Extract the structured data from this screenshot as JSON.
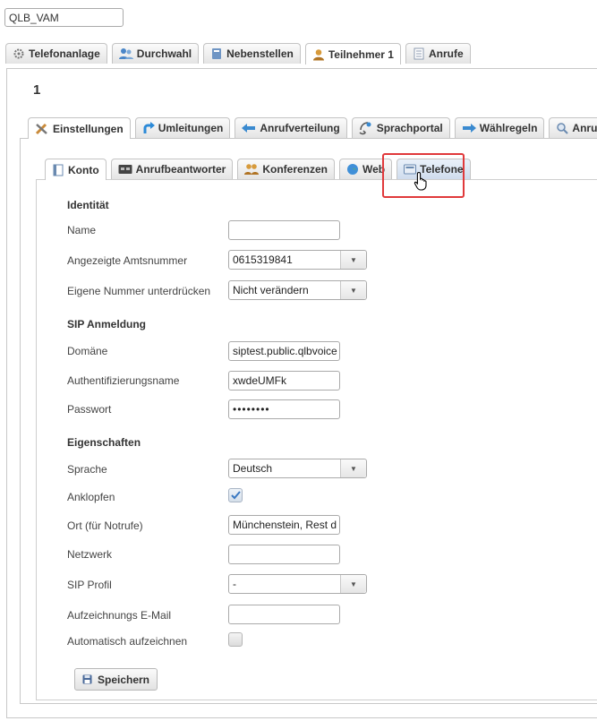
{
  "top_field": {
    "value": "QLB_VAM"
  },
  "main_tabs": [
    {
      "label": "Telefonanlage",
      "icon": "gear-icon"
    },
    {
      "label": "Durchwahl",
      "icon": "people-icon"
    },
    {
      "label": "Nebenstellen",
      "icon": "phonebook-icon"
    },
    {
      "label": "Teilnehmer 1",
      "icon": "user-icon",
      "active": true
    },
    {
      "label": "Anrufe",
      "icon": "list-icon"
    }
  ],
  "participant_number": "1",
  "sub_tabs": [
    {
      "label": "Einstellungen",
      "icon": "tools-icon",
      "active": true
    },
    {
      "label": "Umleitungen",
      "icon": "redirect-arrow-icon"
    },
    {
      "label": "Anrufverteilung",
      "icon": "distribution-arrow-icon"
    },
    {
      "label": "Sprachportal",
      "icon": "voice-portal-icon"
    },
    {
      "label": "Wählregeln",
      "icon": "dial-rules-arrow-icon"
    },
    {
      "label": "Anrufe",
      "icon": "call-search-icon"
    }
  ],
  "inner_tabs": [
    {
      "label": "Konto",
      "icon": "account-icon",
      "active": true
    },
    {
      "label": "Anrufbeantworter",
      "icon": "answering-machine-icon"
    },
    {
      "label": "Konferenzen",
      "icon": "conference-icon"
    },
    {
      "label": "Web",
      "icon": "globe-icon"
    },
    {
      "label": "Telefone",
      "icon": "phone-device-icon",
      "highlighted": true
    }
  ],
  "form": {
    "identity_title": "Identität",
    "name_label": "Name",
    "name_value": "",
    "caller_id_label": "Angezeigte Amtsnummer",
    "caller_id_value": "0615319841",
    "suppress_label": "Eigene Nummer unterdrücken",
    "suppress_value": "Nicht verändern",
    "sip_title": "SIP Anmeldung",
    "domain_label": "Domäne",
    "domain_value": "siptest.public.qlbvoice",
    "auth_label": "Authentifizierungsname",
    "auth_value": "xwdeUMFk",
    "password_label": "Passwort",
    "password_value": "••••••••",
    "props_title": "Eigenschaften",
    "language_label": "Sprache",
    "language_value": "Deutsch",
    "knock_label": "Anklopfen",
    "knock_checked": true,
    "location_label": "Ort (für Notrufe)",
    "location_value": "Münchenstein, Rest d",
    "network_label": "Netzwerk",
    "network_value": "",
    "sip_profile_label": "SIP Profil",
    "sip_profile_value": "-",
    "record_email_label": "Aufzeichnungs E-Mail",
    "record_email_value": "",
    "auto_record_label": "Automatisch aufzeichnen",
    "auto_record_checked": false
  },
  "save_label": "Speichern",
  "colors": {
    "highlight": "#e0393b",
    "check": "#3a78c2"
  }
}
